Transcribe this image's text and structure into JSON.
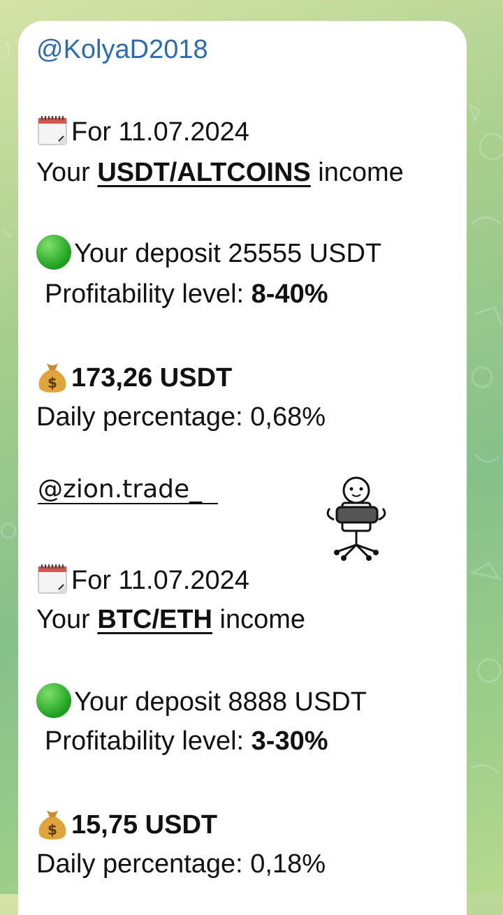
{
  "sender": "@KolyaD2018",
  "block1": {
    "date_line": "For 11.07.2024",
    "income_prefix": "Your ",
    "income_pair": "USDT/ALTCOINS",
    "income_suffix": " income",
    "deposit": "Your deposit 25555 USDT",
    "profit_label": "Profitability level: ",
    "profit_value": "8-40%",
    "amount": "173,26 USDT",
    "daily": "Daily percentage: 0,68%"
  },
  "mention": "@zion.trade_",
  "block2": {
    "date_line": "For 11.07.2024",
    "income_prefix": "Your ",
    "income_pair": "BTC/ETH",
    "income_suffix": " income",
    "deposit": "Your deposit 8888 USDT",
    "profit_label": "Profitability level: ",
    "profit_value": "3-30%",
    "amount": "15,75 USDT",
    "daily": "Daily percentage: 0,18%"
  },
  "icons": [
    "calendar-icon",
    "green-circle-icon",
    "money-bag-icon",
    "office-chair-sticker"
  ],
  "colors": {
    "sender": "#2b6cb0",
    "bubble": "#ffffff",
    "text": "#111111"
  }
}
